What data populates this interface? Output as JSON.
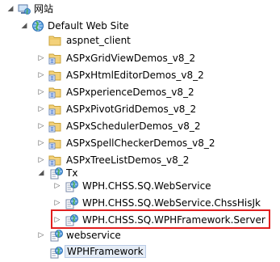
{
  "tree": {
    "root": {
      "label": "网站",
      "icon": "computer-globe-icon"
    },
    "site": {
      "label": "Default Web Site",
      "icon": "globe-icon"
    },
    "folders": [
      {
        "label": "aspnet_client",
        "icon": "folder-icon",
        "expandable": false
      },
      {
        "label": "ASPxGridViewDemos_v8_2",
        "icon": "app-folder-icon",
        "expandable": true
      },
      {
        "label": "ASPxHtmlEditorDemos_v8_2",
        "icon": "app-folder-icon",
        "expandable": true
      },
      {
        "label": "ASPxperienceDemos_v8_2",
        "icon": "app-folder-icon",
        "expandable": true
      },
      {
        "label": "ASPxPivotGridDemos_v8_2",
        "icon": "app-folder-icon",
        "expandable": true
      },
      {
        "label": "ASPxSchedulerDemos_v8_2",
        "icon": "app-folder-icon",
        "expandable": true
      },
      {
        "label": "ASPxSpellCheckerDemos_v8_2",
        "icon": "app-folder-icon",
        "expandable": true
      },
      {
        "label": "ASPxTreeListDemos_v8_2",
        "icon": "app-folder-icon",
        "expandable": true
      }
    ],
    "tx": {
      "label": "Tx",
      "icon": "globe-app-icon",
      "children": [
        {
          "label": "WPH.CHSS.SQ.WebService",
          "icon": "globe-app-icon"
        },
        {
          "label": "WPH.CHSS.SQ.WebService.ChssHisJk",
          "icon": "globe-app-icon"
        },
        {
          "label": "WPH.CHSS.SQ.WPHFramework.Server",
          "icon": "globe-app-icon"
        }
      ]
    },
    "webservice": {
      "label": "webservice",
      "icon": "globe-app-icon"
    },
    "wphframework": {
      "label": "WPHFramework",
      "icon": "globe-app-icon"
    }
  },
  "colors": {
    "highlight_border": "#e21f1f",
    "selection_bg": "#e5ecf6"
  }
}
